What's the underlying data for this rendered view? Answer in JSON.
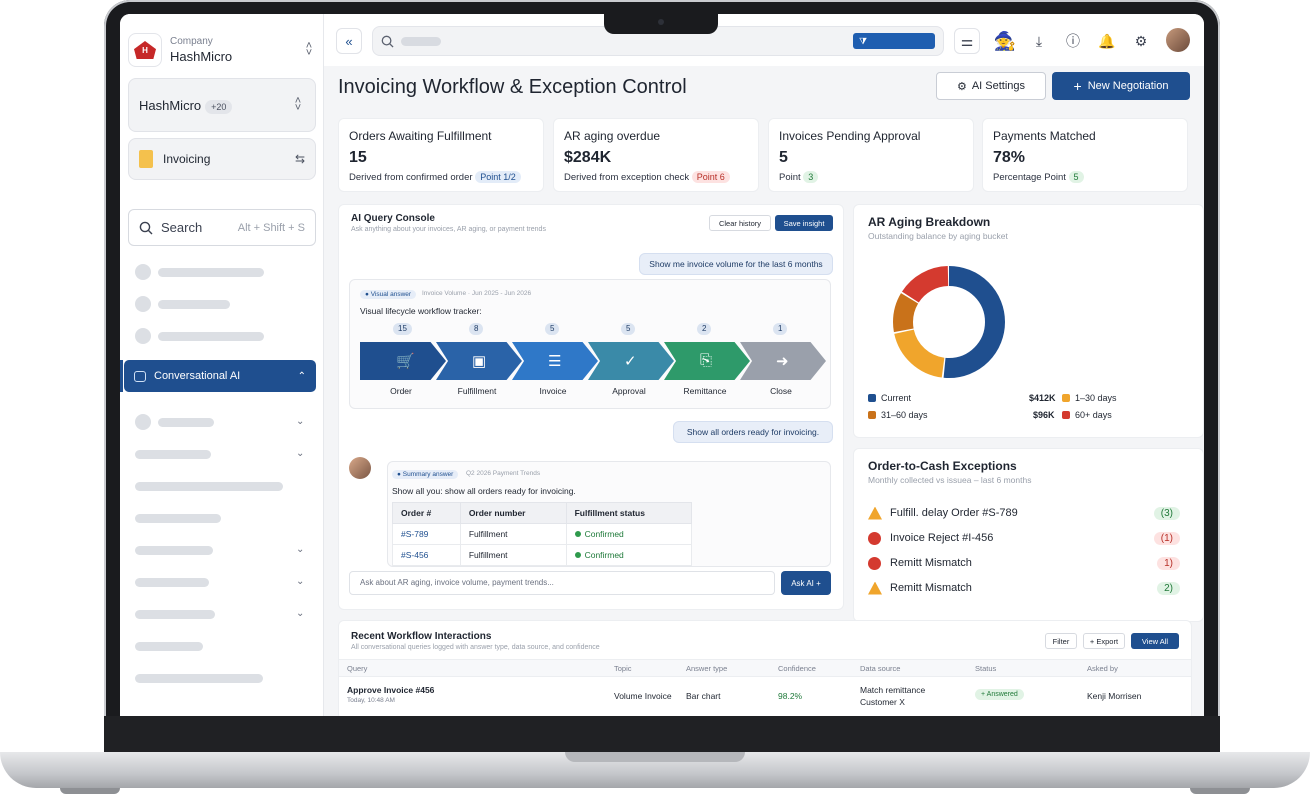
{
  "sidebar": {
    "company_label": "Company",
    "company_name": "HashMicro",
    "workspace": "HashMicro",
    "workspace_extra": "+20",
    "module": "Invoicing",
    "search_placeholder": "Search",
    "search_shortcut": "Alt + Shift + S",
    "active_item": "Conversational AI"
  },
  "header": {
    "title": "Invoicing Workflow & Exception Control",
    "ai_settings": "AI Settings",
    "new_negotiation": "New Negotiation"
  },
  "kpis": [
    {
      "label": "Orders Awaiting Fulfillment",
      "value": "15",
      "sub": "Derived from confirmed order",
      "badge": "Point 1/2"
    },
    {
      "label": "AR aging overdue",
      "value": "$284K",
      "sub": "Derived from exception check",
      "badge": "Point 6"
    },
    {
      "label": "Invoices Pending Approval",
      "value": "5",
      "sub": "Point",
      "badge": "3"
    },
    {
      "label": "Payments Matched",
      "value": "78%",
      "sub": "Percentage Point",
      "badge": "5"
    }
  ],
  "console": {
    "title": "AI Query Console",
    "subtitle": "Ask anything about your invoices, AR aging, or payment trends",
    "clear": "Clear history",
    "save": "Save insight",
    "q1": "Show me invoice volume for the last 6 months",
    "visual_tag": "Visual answer",
    "visual_note": "Invoice Volume · Jun 2025 - Jun 2026",
    "visual_title": "Visual lifecycle workflow tracker:",
    "stages": [
      {
        "label": "Order",
        "count": "15",
        "color": "#1f4f8f"
      },
      {
        "label": "Fulfillment",
        "count": "8",
        "color": "#2a63a8"
      },
      {
        "label": "Invoice",
        "count": "5",
        "color": "#2f78c8"
      },
      {
        "label": "Approval",
        "count": "5",
        "color": "#3a8aa8"
      },
      {
        "label": "Remittance",
        "count": "2",
        "color": "#2e9a6a"
      },
      {
        "label": "Close",
        "count": "1",
        "color": "#9aa0ab"
      }
    ],
    "q2": "Show all orders ready for invoicing.",
    "summary_tag": "Summary answer",
    "summary_note": "Q2 2026 Payment Trends",
    "summary_text": "Show all you: show all orders ready for invoicing.",
    "table_headers": [
      "Order #",
      "Order number",
      "Fulfillment status"
    ],
    "rows": [
      [
        "#S-789",
        "Fulfillment",
        "Confirmed"
      ],
      [
        "#S-456",
        "Fulfillment",
        "Confirmed"
      ]
    ],
    "ask_placeholder": "Ask about AR aging, invoice volume, payment trends...",
    "ask_button": "Ask AI +"
  },
  "aging": {
    "title": "AR Aging Breakdown",
    "subtitle": "Outstanding balance by aging bucket",
    "legend": [
      {
        "label": "Current",
        "color": "#1f4f8f"
      },
      {
        "label": "1–30 days",
        "color": "#f0a52c"
      },
      {
        "label": "31–60 days",
        "color": "#c9721a"
      },
      {
        "label": "60+ days",
        "color": "#d43a2f"
      }
    ],
    "values": [
      "$412K",
      "$96K"
    ],
    "chart_shares": [
      52,
      20,
      12,
      16
    ]
  },
  "exceptions": {
    "title": "Order-to-Cash Exceptions",
    "subtitle": "Monthly collected vs issuea – last 6 months",
    "items": [
      {
        "label": "Fulfill. delay Order #S-789",
        "count": "(3)",
        "kind": "warn"
      },
      {
        "label": "Invoice Reject #I-456",
        "count": "(1)",
        "kind": "error"
      },
      {
        "label": "Remitt Mismatch",
        "count": "1)",
        "kind": "error"
      },
      {
        "label": "Remitt Mismatch",
        "count": "2)",
        "kind": "warn"
      }
    ]
  },
  "recent": {
    "title": "Recent Workflow Interactions",
    "subtitle": "All conversational queries logged with answer type, data source, and confidence",
    "filter": "Filter",
    "export": "+ Export",
    "view_all": "View All",
    "headers": [
      "Query",
      "Topic",
      "Answer type",
      "Confidence",
      "Data source",
      "Status",
      "Asked by"
    ],
    "row": {
      "query": "Approve Invoice #456",
      "time": "Today, 10:48 AM",
      "topic": "Volume Invoice",
      "answer": "Bar chart",
      "confidence": "98.2%",
      "source1": "Match remittance",
      "source2": "Customer X",
      "status": "+ Answered",
      "asked_by": "Kenji Morrisen"
    }
  }
}
